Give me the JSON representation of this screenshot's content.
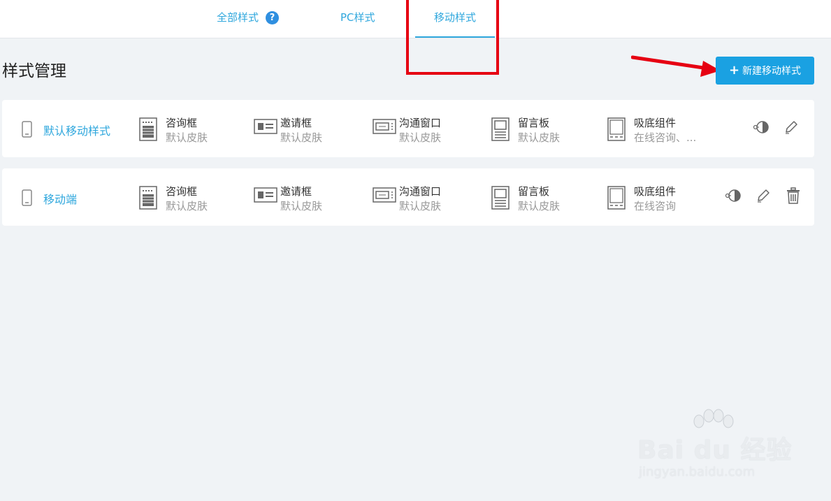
{
  "tabs": [
    {
      "label": "全部样式"
    },
    {
      "label": "PC样式"
    },
    {
      "label": "移动样式"
    }
  ],
  "help_icon_glyph": "?",
  "page_title": "样式管理",
  "new_button": {
    "plus": "+",
    "label": "新建移动样式"
  },
  "styles": [
    {
      "name": "默认移动样式",
      "components": [
        {
          "icon": "consult-box-icon",
          "name": "咨询框",
          "skin": "默认皮肤"
        },
        {
          "icon": "invite-box-icon",
          "name": "邀请框",
          "skin": "默认皮肤"
        },
        {
          "icon": "chat-window-icon",
          "name": "沟通窗口",
          "skin": "默认皮肤"
        },
        {
          "icon": "message-board-icon",
          "name": "留言板",
          "skin": "默认皮肤"
        },
        {
          "icon": "bottom-widget-icon",
          "name": "吸底组件",
          "skin": "在线咨询、..."
        }
      ],
      "actions": [
        "preview-icon",
        "edit-icon"
      ]
    },
    {
      "name": "移动端",
      "components": [
        {
          "icon": "consult-box-icon",
          "name": "咨询框",
          "skin": "默认皮肤"
        },
        {
          "icon": "invite-box-icon",
          "name": "邀请框",
          "skin": "默认皮肤"
        },
        {
          "icon": "chat-window-icon",
          "name": "沟通窗口",
          "skin": "默认皮肤"
        },
        {
          "icon": "message-board-icon",
          "name": "留言板",
          "skin": "默认皮肤"
        },
        {
          "icon": "bottom-widget-icon",
          "name": "吸底组件",
          "skin": "在线咨询"
        }
      ],
      "actions": [
        "preview-icon",
        "edit-icon",
        "delete-icon"
      ]
    }
  ],
  "watermark": {
    "brand": "Bai du 经验",
    "url": "jingyan.baidu.com"
  },
  "colors": {
    "accent": "#1aa1e2",
    "link": "#2fa7dd",
    "annotation": "#e60012"
  }
}
